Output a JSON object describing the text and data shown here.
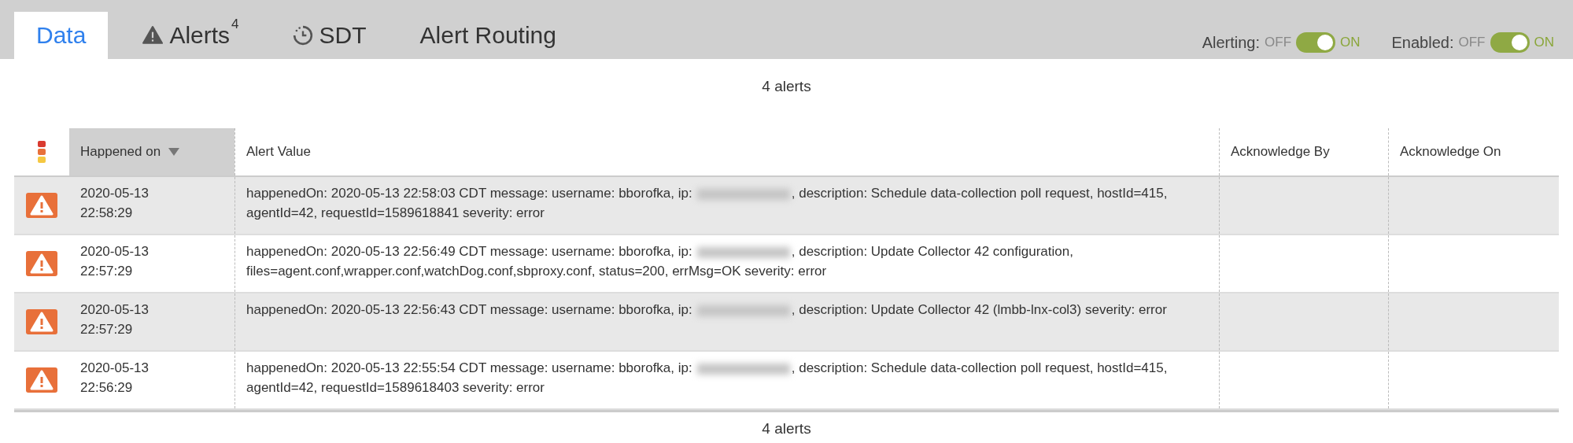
{
  "tabs": [
    {
      "label": "Data",
      "selected": true,
      "kind": "plain"
    },
    {
      "label": "Alerts",
      "badge": "4",
      "selected": false,
      "kind": "alerts"
    },
    {
      "label": "SDT",
      "selected": false,
      "kind": "sdt"
    },
    {
      "label": "Alert Routing",
      "selected": false,
      "kind": "plain"
    }
  ],
  "toggles": [
    {
      "label": "Alerting:",
      "off_label": "OFF",
      "on_label": "ON",
      "on": true
    },
    {
      "label": "Enabled:",
      "off_label": "OFF",
      "on_label": "ON",
      "on": true
    }
  ],
  "count_top": "4 alerts",
  "table": {
    "columns": [
      {
        "label": "Happened on",
        "sorted": true
      },
      {
        "label": "Alert Value",
        "sorted": false
      },
      {
        "label": "Acknowledge By",
        "sorted": false
      },
      {
        "label": "Acknowledge On",
        "sorted": false
      }
    ],
    "rows": [
      {
        "date": "2020-05-13",
        "time": "22:58:29",
        "value_before_ip": "happenedOn: 2020-05-13 22:58:03 CDT message: username: bborofka, ip:",
        "value_after_ip": ", description: Schedule data-collection poll request, hostId=415, agentId=42, requestId=1589618841 severity: error"
      },
      {
        "date": "2020-05-13",
        "time": "22:57:29",
        "value_before_ip": "happenedOn: 2020-05-13 22:56:49 CDT message: username: bborofka, ip:",
        "value_after_ip": ", description: Update Collector 42 configuration, files=agent.conf,wrapper.conf,watchDog.conf,sbproxy.conf, status=200, errMsg=OK severity: error"
      },
      {
        "date": "2020-05-13",
        "time": "22:57:29",
        "value_before_ip": "happenedOn: 2020-05-13 22:56:43 CDT message: username: bborofka, ip:",
        "value_after_ip": ", description: Update Collector 42 (lmbb-lnx-col3) severity: error"
      },
      {
        "date": "2020-05-13",
        "time": "22:56:29",
        "value_before_ip": "happenedOn: 2020-05-13 22:55:54 CDT message: username: bborofka, ip:",
        "value_after_ip": ", description: Schedule data-collection poll request, hostId=415, agentId=42, requestId=1589618403 severity: error"
      }
    ]
  },
  "count_bottom": "4 alerts"
}
